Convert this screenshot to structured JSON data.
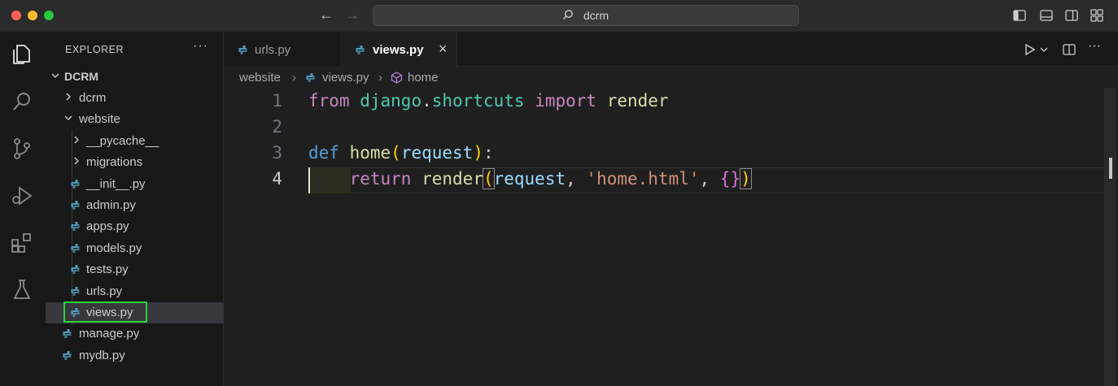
{
  "window": {
    "search_text": "dcrm"
  },
  "sidebar": {
    "title": "EXPLORER",
    "more": "···",
    "root": "DCRM",
    "tree": [
      {
        "label": "dcrm"
      },
      {
        "label": "website"
      },
      {
        "label": "__pycache__"
      },
      {
        "label": "migrations"
      },
      {
        "label": "__init__.py"
      },
      {
        "label": "admin.py"
      },
      {
        "label": "apps.py"
      },
      {
        "label": "models.py"
      },
      {
        "label": "tests.py"
      },
      {
        "label": "urls.py"
      },
      {
        "label": "views.py"
      },
      {
        "label": "manage.py"
      },
      {
        "label": "mydb.py"
      }
    ]
  },
  "tabs": [
    {
      "label": "urls.py"
    },
    {
      "label": "views.py"
    }
  ],
  "breadcrumb": [
    "website",
    "views.py",
    "home"
  ],
  "editor": {
    "line_numbers": [
      "1",
      "2",
      "3",
      "4"
    ],
    "line1": {
      "t1": "from",
      "t2": "django",
      "t3": ".",
      "t4": "shortcuts",
      "t5": "import",
      "t6": "render"
    },
    "line3": {
      "t1": "def",
      "t2": "home",
      "t3": "(",
      "t4": "request",
      "t5": ")",
      "t6": ":"
    },
    "line4": {
      "t1": "return",
      "t2": "render",
      "t3": "(",
      "t4": "request",
      "t5": ", ",
      "t6": "'home.html'",
      "t7": ", ",
      "t8": "{}",
      "t9": ")"
    }
  },
  "colors": {
    "accent_highlight": "#2bd43a",
    "python_icon": "#519aba"
  }
}
